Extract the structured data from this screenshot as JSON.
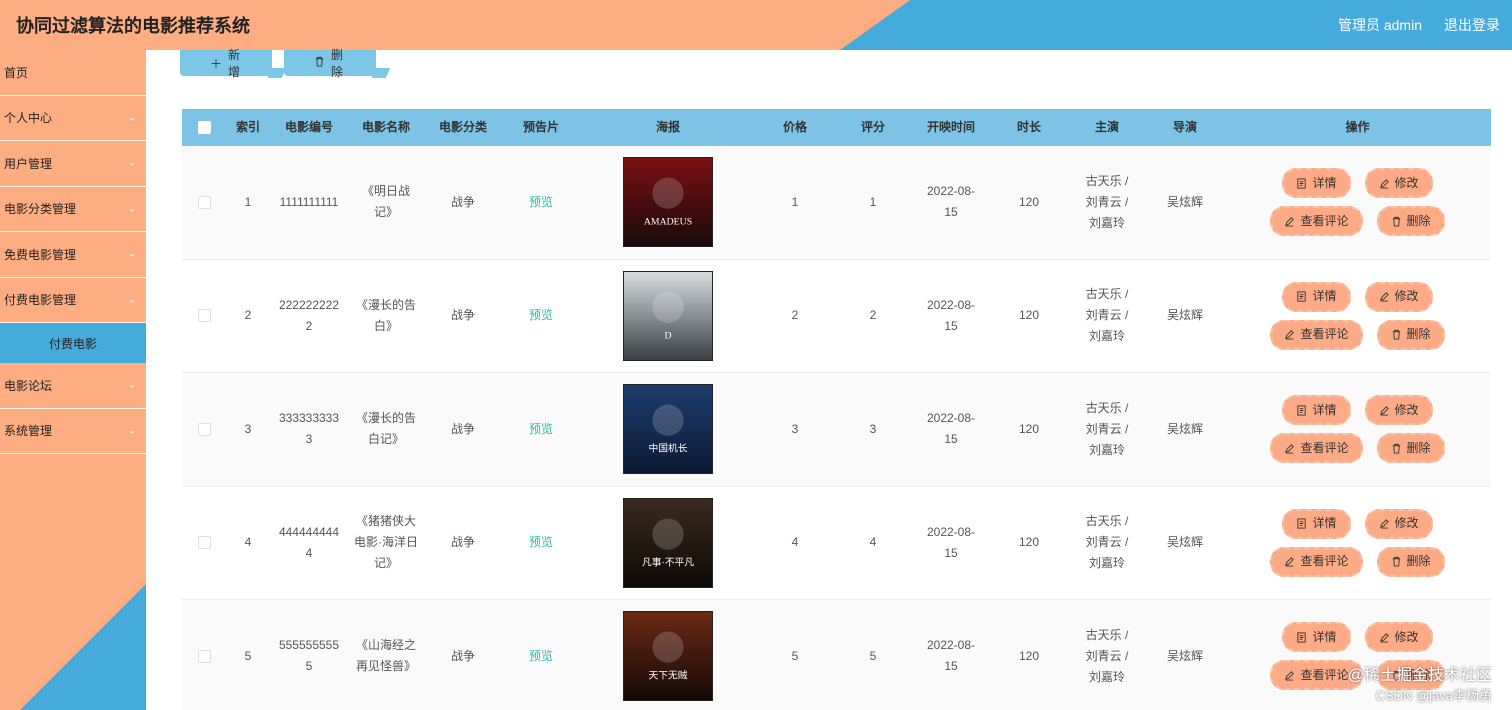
{
  "app": {
    "title": "协同过滤算法的电影推荐系统"
  },
  "header": {
    "user_label": "管理员 admin",
    "logout_label": "退出登录"
  },
  "colors": {
    "peach": "#fead82",
    "blue": "#45abdc",
    "table_head": "#7cc3e5",
    "preview_link": "#2fb8a4"
  },
  "sidebar": {
    "items": [
      {
        "label": "首页",
        "has_chevron": false
      },
      {
        "label": "个人中心",
        "has_chevron": true
      },
      {
        "label": "用户管理",
        "has_chevron": true
      },
      {
        "label": "电影分类管理",
        "has_chevron": true
      },
      {
        "label": "免费电影管理",
        "has_chevron": true
      },
      {
        "label": "付费电影管理",
        "has_chevron": true
      },
      {
        "label": "电影论坛",
        "has_chevron": true
      },
      {
        "label": "系统管理",
        "has_chevron": true
      }
    ],
    "active_sub": "付费电影"
  },
  "toolbar": {
    "add_label": "新增",
    "delete_label": "删除"
  },
  "table": {
    "headers": [
      "索引",
      "电影编号",
      "电影名称",
      "电影分类",
      "预告片",
      "海报",
      "价格",
      "评分",
      "开映时间",
      "时长",
      "主演",
      "导演",
      "操作"
    ],
    "ops": {
      "detail": "详情",
      "edit": "修改",
      "comments": "查看评论",
      "delete": "删除"
    },
    "rows": [
      {
        "index": "1",
        "no": "1111111111",
        "name": "《明日战记》",
        "category": "战争",
        "preview": "预览",
        "poster_text": "AMADEUS",
        "price": "1",
        "rating": "1",
        "date": "2022-08-15",
        "duration": "120",
        "actors": "古天乐 / 刘青云 / 刘嘉玲",
        "director": "吴炫辉"
      },
      {
        "index": "2",
        "no": "2222222222",
        "name": "《漫长的告白》",
        "category": "战争",
        "preview": "预览",
        "poster_text": "D",
        "price": "2",
        "rating": "2",
        "date": "2022-08-15",
        "duration": "120",
        "actors": "古天乐 / 刘青云 / 刘嘉玲",
        "director": "吴炫辉"
      },
      {
        "index": "3",
        "no": "3333333333",
        "name": "《漫长的告白记》",
        "category": "战争",
        "preview": "预览",
        "poster_text": "中国机长",
        "price": "3",
        "rating": "3",
        "date": "2022-08-15",
        "duration": "120",
        "actors": "古天乐 / 刘青云 / 刘嘉玲",
        "director": "吴炫辉"
      },
      {
        "index": "4",
        "no": "4444444444",
        "name": "《猪猪侠大电影·海洋日记》",
        "category": "战争",
        "preview": "预览",
        "poster_text": "凡事·不平凡",
        "price": "4",
        "rating": "4",
        "date": "2022-08-15",
        "duration": "120",
        "actors": "古天乐 / 刘青云 / 刘嘉玲",
        "director": "吴炫辉"
      },
      {
        "index": "5",
        "no": "5555555555",
        "name": "《山海经之再见怪兽》",
        "category": "战争",
        "preview": "预览",
        "poster_text": "天下无贼",
        "price": "5",
        "rating": "5",
        "date": "2022-08-15",
        "duration": "120",
        "actors": "古天乐 / 刘青云 / 刘嘉玲",
        "director": "吴炫辉"
      }
    ]
  },
  "watermark": {
    "line1": "@稀土掘金技术社区",
    "line2": "CSDN @java李杨勇"
  }
}
